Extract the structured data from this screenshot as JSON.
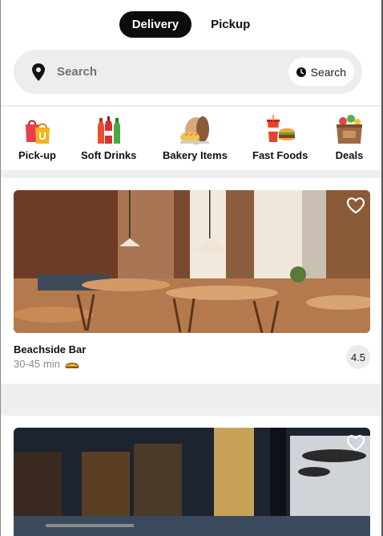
{
  "mode_toggle": {
    "delivery_label": "Delivery",
    "pickup_label": "Pickup",
    "active": "Delivery"
  },
  "search": {
    "placeholder": "Search",
    "value": "",
    "button_label": "Search"
  },
  "categories": [
    {
      "label": "Pick-up",
      "icon": "shopping-bags-icon"
    },
    {
      "label": "Soft Drinks",
      "icon": "soda-bottles-icon"
    },
    {
      "label": "Bakery Items",
      "icon": "bread-icon"
    },
    {
      "label": "Fast Foods",
      "icon": "burger-soda-icon"
    },
    {
      "label": "Deals",
      "icon": "grocery-bag-icon"
    }
  ],
  "restaurants": [
    {
      "name": "Beachside Bar",
      "delivery_time": "30-45 min",
      "rating": "4.5",
      "favorite_icon": "heart-outline-icon",
      "time_icon": "dumpling-icon"
    },
    {
      "name": "",
      "delivery_time": "",
      "rating": "",
      "favorite_icon": "heart-outline-icon"
    }
  ],
  "colors": {
    "active_toggle": "#0c0c0c",
    "search_bg": "#ededed",
    "band": "#efefef",
    "muted_text": "#8a8a8a"
  }
}
